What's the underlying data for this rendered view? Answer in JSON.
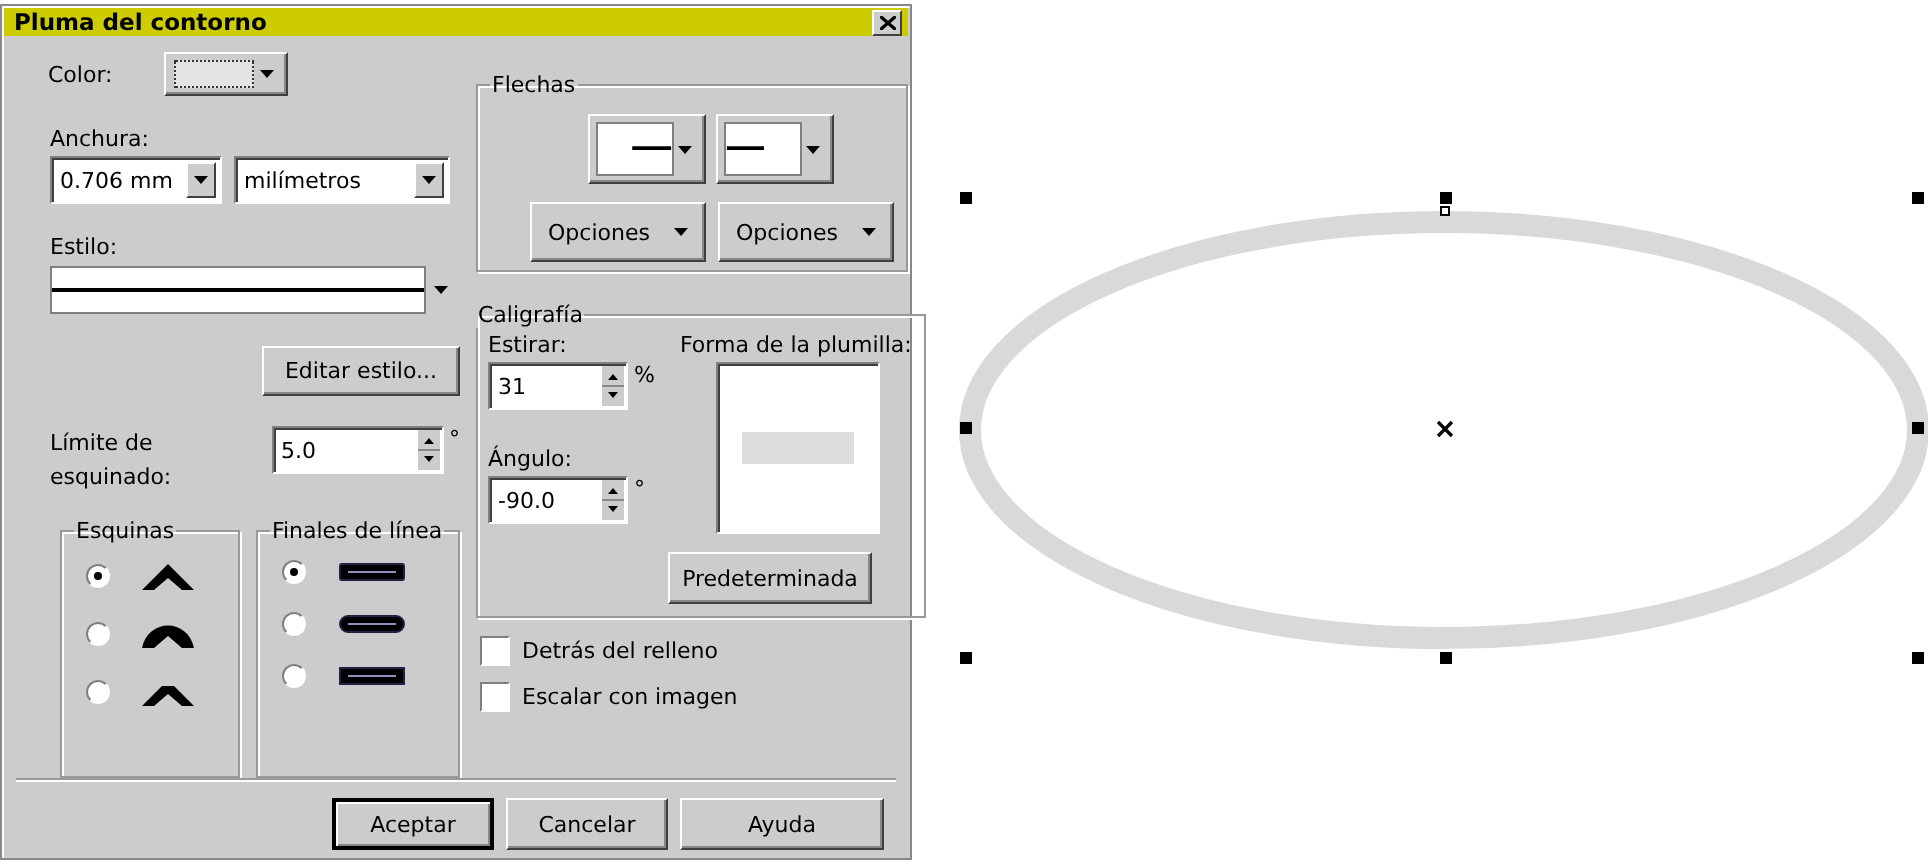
{
  "dialog": {
    "title": "Pluma del contorno",
    "color": {
      "label": "Color:"
    },
    "width": {
      "label": "Anchura:",
      "value": "0.706 mm",
      "units": "milímetros"
    },
    "style": {
      "label": "Estilo:"
    },
    "edit_style_button": "Editar estilo...",
    "miter_limit": {
      "label": "Límite de esquinado:",
      "value": "5.0",
      "unit": "°"
    },
    "corners": {
      "title": "Esquinas",
      "options": [
        {
          "kind": "miter",
          "selected": true
        },
        {
          "kind": "round",
          "selected": false
        },
        {
          "kind": "bevel",
          "selected": false
        }
      ]
    },
    "line_ends": {
      "title": "Finales de línea",
      "options": [
        {
          "kind": "butt",
          "selected": true
        },
        {
          "kind": "round",
          "selected": false
        },
        {
          "kind": "square",
          "selected": false
        }
      ]
    },
    "arrows": {
      "title": "Flechas",
      "options_buttons": [
        {
          "label": "Opciones"
        },
        {
          "label": "Opciones"
        }
      ]
    },
    "calligraphy": {
      "title": "Caligrafía",
      "stretch": {
        "label": "Estirar:",
        "value": "31",
        "unit": "%"
      },
      "nib_label": "Forma de la plumilla:",
      "angle": {
        "label": "Ángulo:",
        "value": "-90.0",
        "unit": "°"
      },
      "default_button": "Predeterminada"
    },
    "checkboxes": [
      {
        "label": "Detrás del relleno",
        "checked": false
      },
      {
        "label": "Escalar con imagen",
        "checked": false
      }
    ],
    "buttons": [
      {
        "label": "Aceptar",
        "default": true
      },
      {
        "label": "Cancelar",
        "default": false
      },
      {
        "label": "Ayuda",
        "default": false
      }
    ]
  }
}
